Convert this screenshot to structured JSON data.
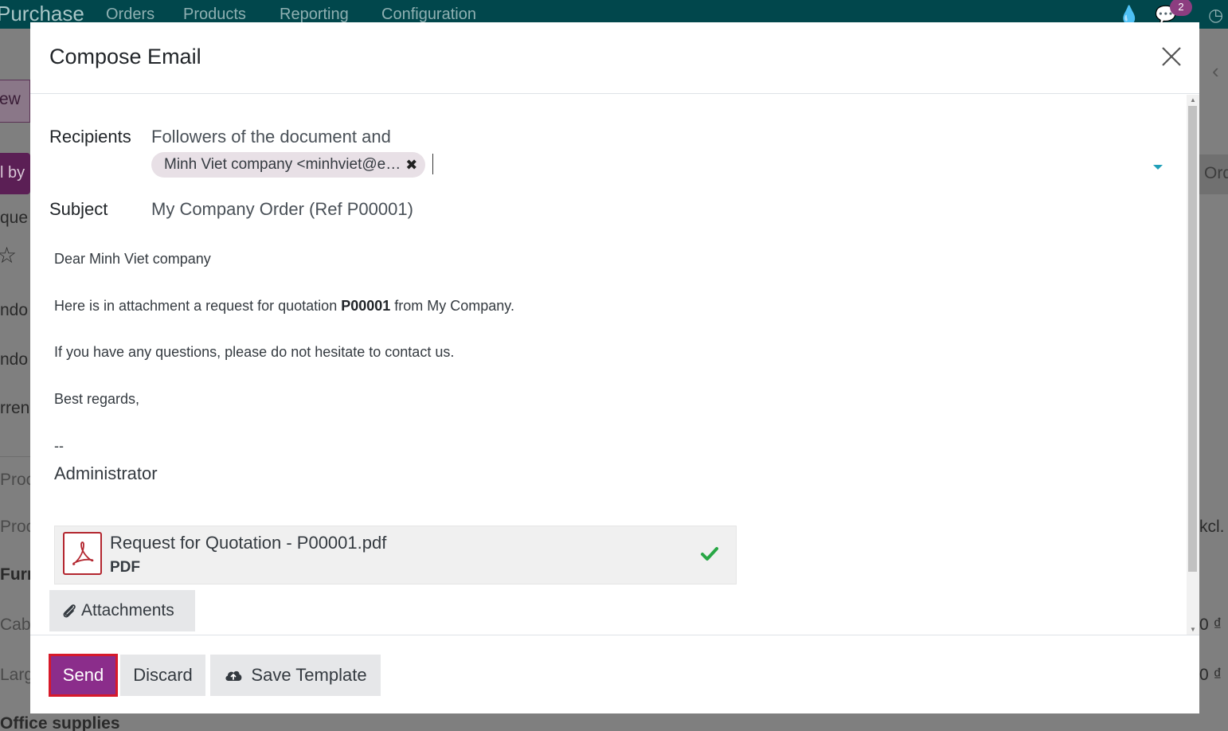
{
  "app": {
    "brand": "Purchase",
    "menu": [
      "Orders",
      "Products",
      "Reporting",
      "Configuration"
    ],
    "notification_count": "2",
    "background_fragments": {
      "new": "ew",
      "by": "l by",
      "que": "que",
      "ndo1": "ndo",
      "ndo2": "ndo",
      "rren": "rren",
      "proc1": "Proc",
      "proc2": "Proc",
      "furn": "Furn",
      "cab": "Cab",
      "larg": "Larg",
      "office": "Office supplies",
      "ord": "Ord",
      "kcl": "kcl.",
      "amount1": "0 ₫",
      "amount2": "0 ₫"
    }
  },
  "dialog": {
    "title": "Compose Email",
    "recipients_label": "Recipients",
    "recipients_prefix": "Followers of the document and",
    "recipient_tag": "Minh Viet company <minhviet@e…",
    "subject_label": "Subject",
    "subject_value": "My Company Order (Ref P00001)",
    "body": {
      "greeting": "Dear Minh Viet company",
      "line1_before": "Here is in attachment a request for quotation ",
      "line1_ref": "P00001",
      "line1_after": " from My Company.",
      "line2": "If you have any questions, please do not hesitate to contact us.",
      "closing": "Best regards,",
      "sig_sep": "--",
      "signature": "Administrator"
    },
    "attachment": {
      "name": "Request for Quotation - P00001.pdf",
      "type": "PDF"
    },
    "attachments_button": "Attachments",
    "footer": {
      "send": "Send",
      "discard": "Discard",
      "save_template": "Save Template"
    }
  },
  "colors": {
    "topbar": "#01474c",
    "primary": "#8b2d8b",
    "highlight_border": "#d7192a",
    "check": "#28a745",
    "pdf": "#b3262f"
  }
}
